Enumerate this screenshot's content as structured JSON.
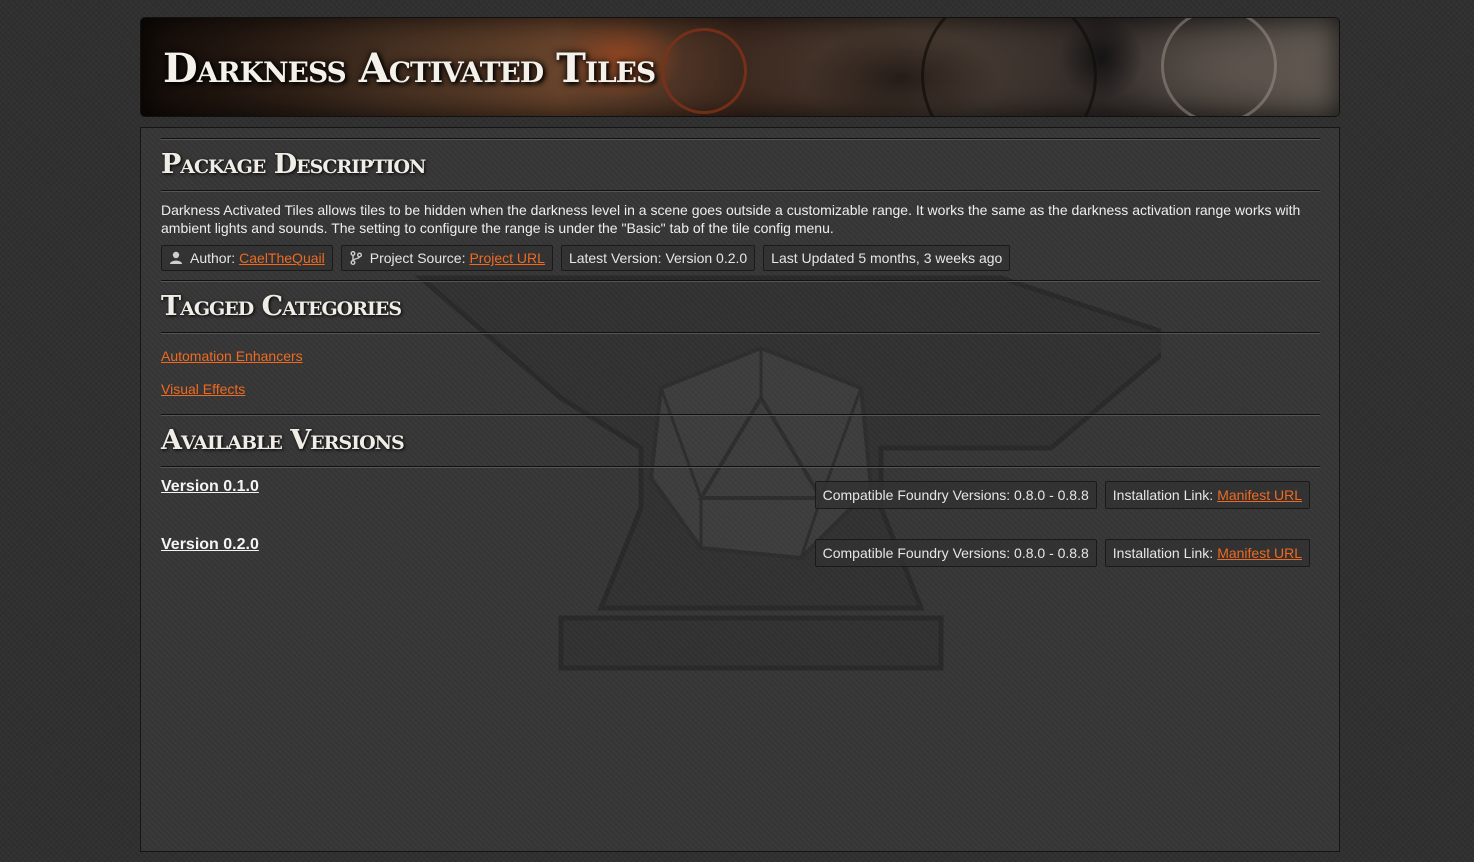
{
  "banner": {
    "title": "Darkness Activated Tiles"
  },
  "description": {
    "heading": "Package Description",
    "text": "Darkness Activated Tiles allows tiles to be hidden when the darkness level in a scene goes outside a customizable range. It works the same as the darkness activation range works with ambient lights and sounds. The setting to configure the range is under the \"Basic\" tab of the tile config menu.",
    "author_label": "Author:",
    "author_link": "CaelTheQuail",
    "author_icon": "user-icon",
    "source_label": "Project Source:",
    "source_link": "Project URL",
    "source_icon": "code-branch-icon",
    "latest_version": "Latest Version: Version 0.2.0",
    "last_updated": "Last Updated 5 months, 3 weeks ago"
  },
  "categories": {
    "heading": "Tagged Categories",
    "items": [
      "Automation Enhancers",
      "Visual Effects"
    ]
  },
  "versions": {
    "heading": "Available Versions",
    "items": [
      {
        "name": "Version 0.1.0",
        "compat": "Compatible Foundry Versions: 0.8.0 - 0.8.8",
        "install_label": "Installation Link:",
        "install_link": "Manifest URL"
      },
      {
        "name": "Version 0.2.0",
        "compat": "Compatible Foundry Versions: 0.8.0 - 0.8.8",
        "install_label": "Installation Link:",
        "install_link": "Manifest URL"
      }
    ]
  },
  "colors": {
    "link": "#ee6a22",
    "background": "#303030",
    "text": "#e8e8e8"
  }
}
